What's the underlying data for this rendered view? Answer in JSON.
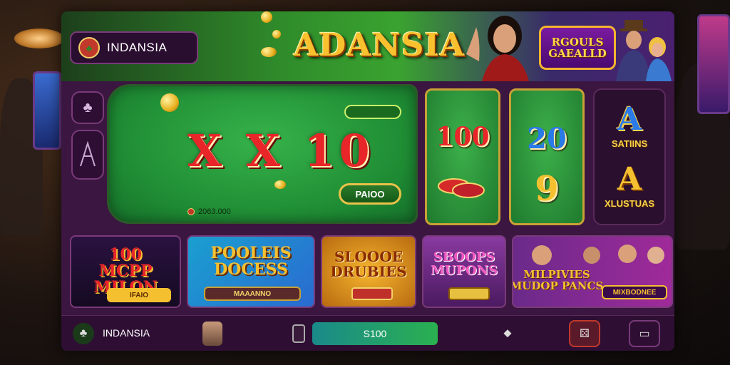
{
  "brand": {
    "name": "INDANSIA"
  },
  "hero": {
    "title": "ADANSIA",
    "badge_line1": "RGOULS",
    "badge_line2": "GAEALLD"
  },
  "table": {
    "tag": "",
    "multiplier": "X X 10",
    "play_label": "PAIOO",
    "balance": "2063.000"
  },
  "cards": {
    "card1_num": "100",
    "card2_num_top": "20",
    "card2_num_bottom": "9",
    "letter_top": "A",
    "letter_top_caption": "SATIINS",
    "letter_bottom": "A",
    "letter_bottom_caption": "XLUSTUAS"
  },
  "tiles": [
    {
      "title": "100\nMCPP MILON",
      "button": "IFAIO"
    },
    {
      "title": "POOLEIS\nDOCESS",
      "button": "MAAANNO"
    },
    {
      "title": "SLOOOE\nDRUBIES",
      "button": ""
    },
    {
      "title": "SBOOPS\nMUPONS",
      "button": ""
    },
    {
      "title": "MILPIVIES\nMUDOP PANCS",
      "button": "MIXBODNEE"
    }
  ],
  "bottom_bar": {
    "brand": "INDANSIA",
    "small_label": "",
    "amount": "S100"
  },
  "colors": {
    "accent_gold": "#f5b52e",
    "felt_green": "#2aa33e",
    "panel_purple": "#3b1640"
  }
}
